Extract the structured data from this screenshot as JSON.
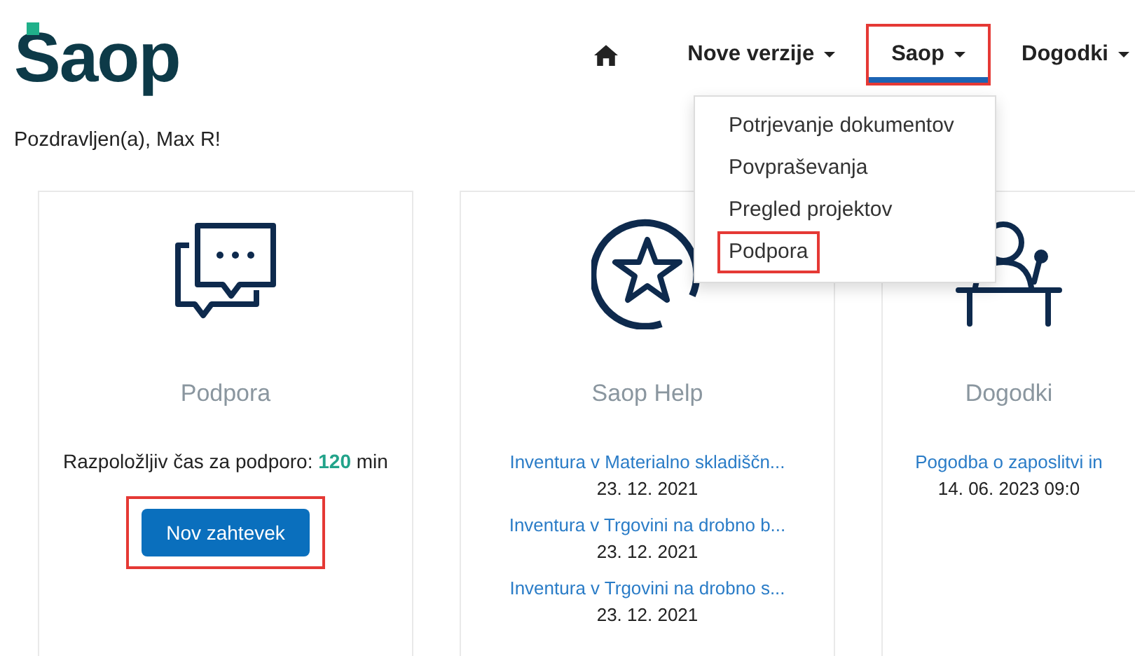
{
  "logo": "Saop",
  "nav": [
    {
      "kind": "home"
    },
    {
      "kind": "menu",
      "label": "Nove verzije",
      "selected": false,
      "highlighted": false
    },
    {
      "kind": "menu",
      "label": "Saop",
      "selected": true,
      "highlighted": true
    },
    {
      "kind": "menu",
      "label": "Dogodki",
      "selected": false,
      "highlighted": false
    }
  ],
  "greeting": "Pozdravljen(a), Max R!",
  "dropdown": {
    "items": [
      {
        "label": "Potrjevanje dokumentov",
        "highlighted": false
      },
      {
        "label": "Povpraševanja",
        "highlighted": false
      },
      {
        "label": "Pregled projektov",
        "highlighted": false
      },
      {
        "label": "Podpora",
        "highlighted": true
      }
    ]
  },
  "cards": [
    {
      "kind": "chat",
      "title": "Podpora",
      "text": "Razpoložljiv čas za podporo: **120** min",
      "button": {
        "label": "Nov zahtevek",
        "highlighted": true
      }
    },
    {
      "kind": "star",
      "title": "Saop Help",
      "links": [
        {
          "title": "Inventura v Materialno skladiščn...",
          "date": "23. 12. 2021"
        },
        {
          "title": "Inventura v Trgovini na drobno b...",
          "date": "23. 12. 2021"
        },
        {
          "title": "Inventura v Trgovini na drobno s...",
          "date": "23. 12. 2021"
        }
      ]
    },
    {
      "kind": "podium",
      "title": "Dogodki",
      "links": [
        {
          "title": "Pogodba o zaposlitvi in",
          "date": "14. 06. 2023 09:0"
        }
      ]
    }
  ]
}
